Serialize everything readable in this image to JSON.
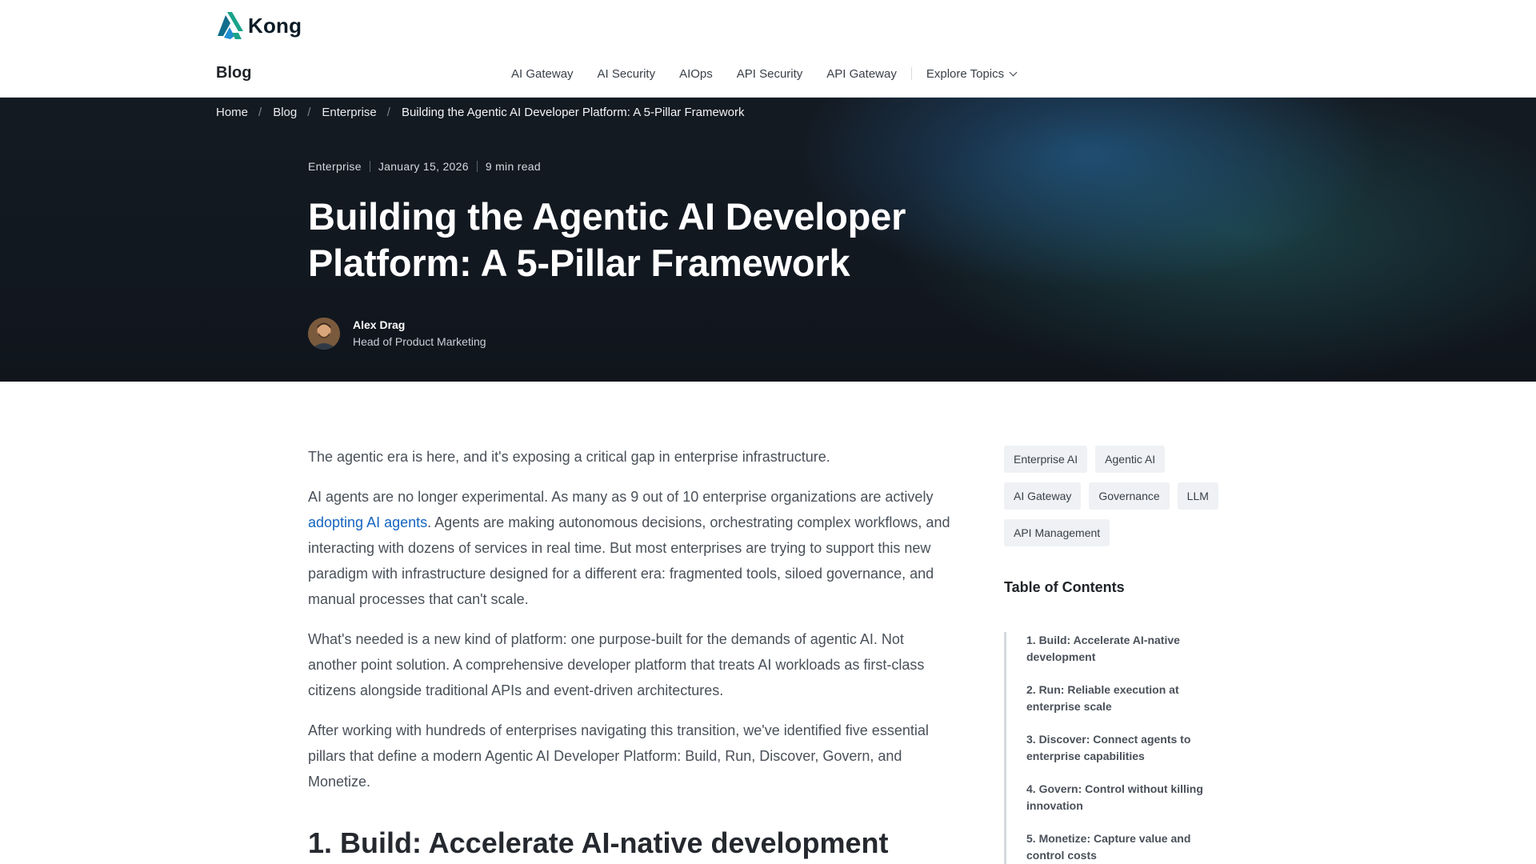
{
  "brand": {
    "logo_text": "Kong",
    "accent": "#1aa38a",
    "accent_dark": "#0f6e8c"
  },
  "header": {
    "blog_title": "Blog",
    "nav": [
      {
        "label": "AI Gateway"
      },
      {
        "label": "AI Security"
      },
      {
        "label": "AIOps"
      },
      {
        "label": "API Security"
      },
      {
        "label": "API Gateway"
      }
    ],
    "explore_label": "Explore Topics"
  },
  "breadcrumb": {
    "items": [
      "Home",
      "Blog",
      "Enterprise"
    ],
    "current": "Building the Agentic AI Developer Platform: A 5-Pillar Framework",
    "separator": "/"
  },
  "hero": {
    "category": "Enterprise",
    "date": "January 15, 2026",
    "read_time": "9 min read",
    "title": "Building the Agentic AI Developer Platform: A 5-Pillar Framework",
    "author_name": "Alex Drag",
    "author_role": "Head of Product Marketing"
  },
  "article": {
    "p1": "The agentic era is here, and it's exposing a critical gap in enterprise infrastructure.",
    "p2_before": "AI agents are no longer experimental. As many as 9 out of 10 enterprise organizations are actively ",
    "p2_link": "adopting AI agents",
    "p2_after": ". Agents are making autonomous decisions, orchestrating complex workflows, and interacting with dozens of services in real time. But most enterprises are trying to support this new paradigm with infrastructure designed for a different era: fragmented tools, siloed governance, and manual processes that can't scale.",
    "p3": "What's needed is a new kind of platform: one purpose-built for the demands of agentic AI. Not another point solution. A comprehensive developer platform that treats AI workloads as first-class citizens alongside traditional APIs and event-driven architectures.",
    "p4": "After working with hundreds of enterprises navigating this transition, we've identified five essential pillars that define a modern Agentic AI Developer Platform: Build, Run, Discover, Govern, and Monetize.",
    "heading1": "1. Build: Accelerate AI-native development"
  },
  "sidebar": {
    "tags": [
      "Enterprise AI",
      "Agentic AI",
      "AI Gateway",
      "Governance",
      "LLM",
      "API Management"
    ],
    "toc_title": "Table of Contents",
    "toc": [
      "1. Build: Accelerate AI-native development",
      "2. Run: Reliable execution at enterprise scale",
      "3. Discover: Connect agents to enterprise capabilities",
      "4. Govern: Control without killing innovation",
      "5. Monetize: Capture value and control costs"
    ]
  }
}
